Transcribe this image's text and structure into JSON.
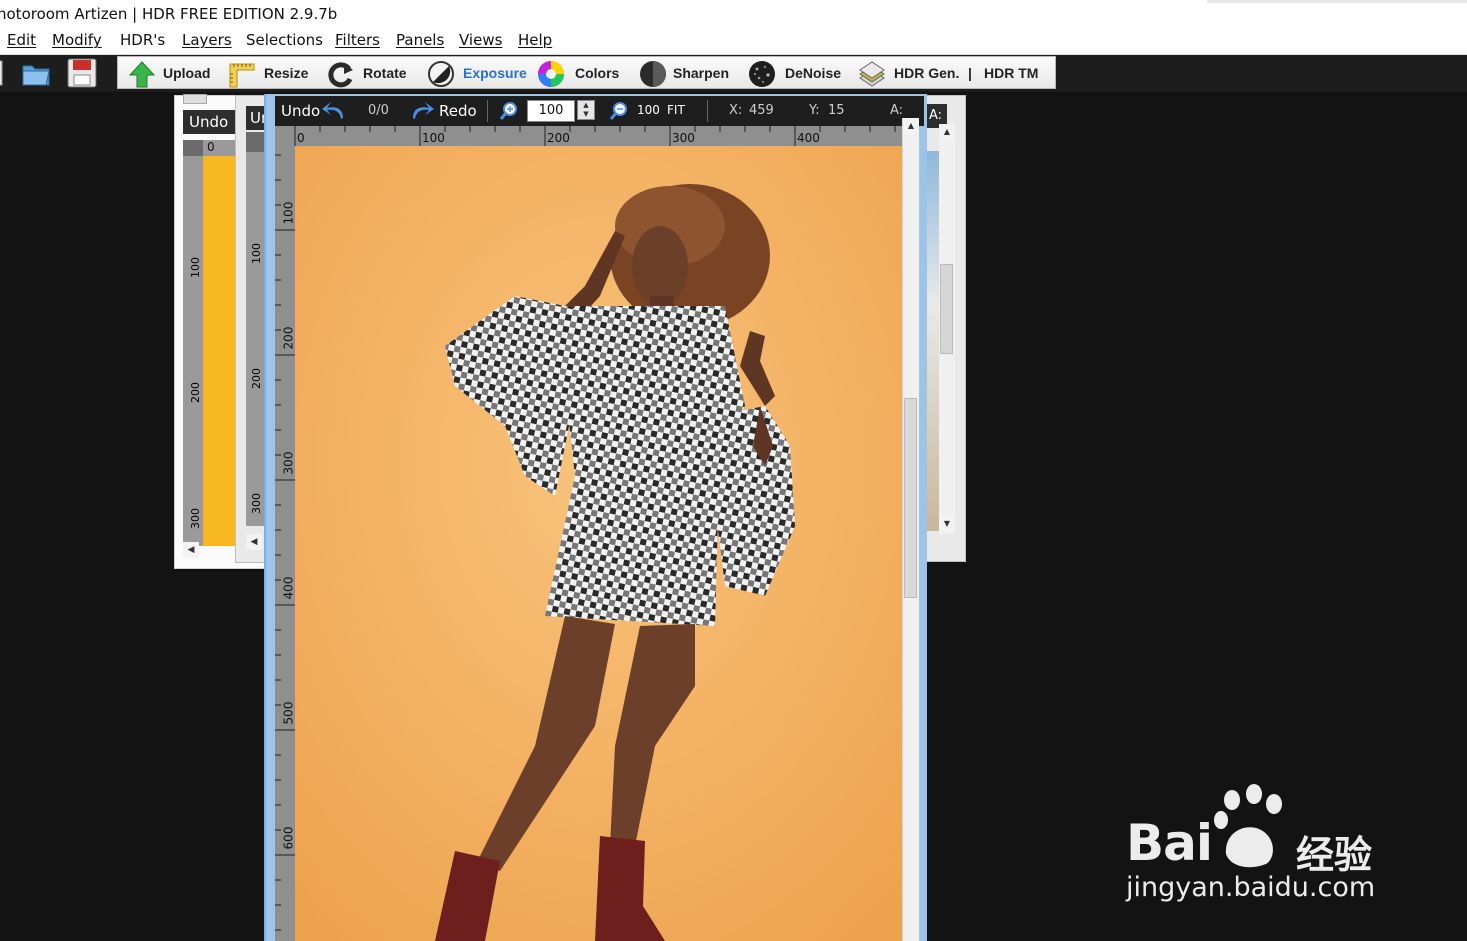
{
  "window": {
    "title": "hotoroom Artizen | HDR FREE EDITION 2.9.7b"
  },
  "menu": [
    "Edit",
    "Modify",
    "HDR's",
    "Layers",
    "Selections",
    "Filters",
    "Panels",
    "Views",
    "Help"
  ],
  "toolbar": {
    "upload": "Upload",
    "resize": "Resize",
    "rotate": "Rotate",
    "exposure": "Exposure",
    "colors": "Colors",
    "sharpen": "Sharpen",
    "denoise": "DeNoise",
    "hdr_gen": "HDR Gen.",
    "separator": "|",
    "hdr_tm": "HDR TM"
  },
  "panel_left": {
    "title": "Undo",
    "ruler_zero": "0",
    "ruler_labels": [
      "100",
      "200",
      "300"
    ],
    "color": "#f8b820"
  },
  "panel_middle": {
    "title": "Ur",
    "ruler_labels": [
      "100",
      "200",
      "300"
    ]
  },
  "panel_right": {
    "title": "A:"
  },
  "editor": {
    "undo_label": "Undo",
    "undo_count": "0/0",
    "redo_label": "Redo",
    "zoom_value": "100",
    "zoom_100_label": "100",
    "fit_label": "FIT",
    "x_label": "X:",
    "x_value": "459",
    "y_label": "Y:",
    "y_value": "15",
    "a_label": "A:",
    "hruler_labels": [
      "0",
      "100",
      "200",
      "300",
      "400"
    ],
    "vruler_labels": [
      "100",
      "200",
      "300",
      "400",
      "500",
      "600"
    ]
  },
  "watermark": {
    "brand": "Bai",
    "brand_cn": "经验",
    "url": "jingyan.baidu.com"
  },
  "colors": {
    "background": "#131313",
    "photo_background": "#f5b363",
    "accent_blue": "#2d6fd8"
  }
}
